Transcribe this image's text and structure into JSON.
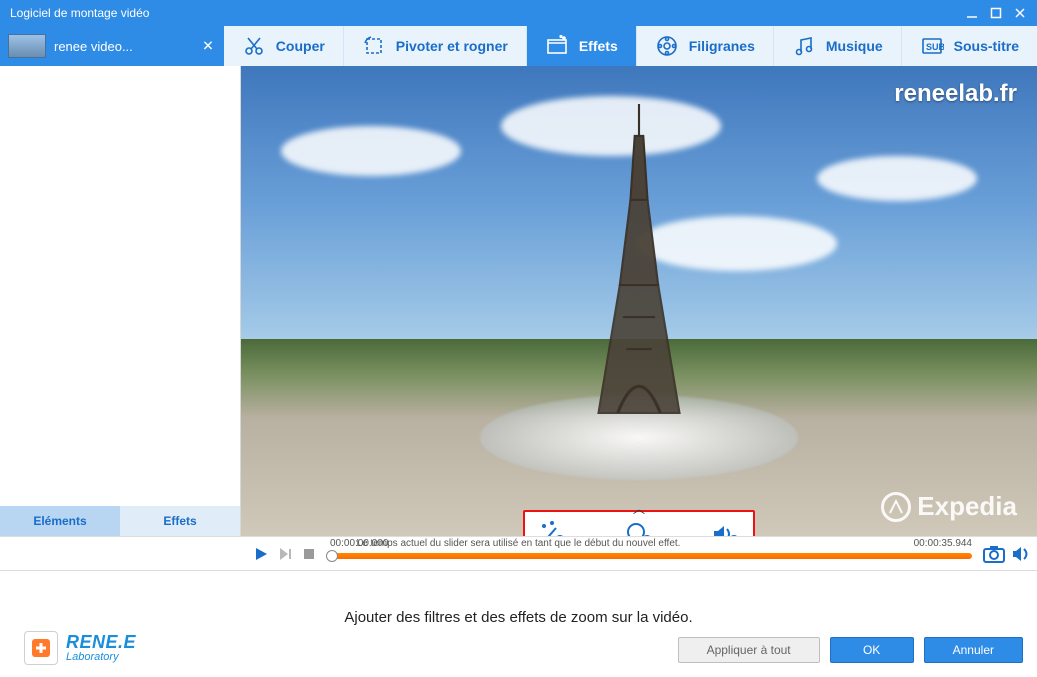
{
  "window": {
    "title": "Logiciel de montage vidéo"
  },
  "file_tab": {
    "label": "renee video...",
    "close": "✕"
  },
  "tools": [
    {
      "id": "couper",
      "label": "Couper"
    },
    {
      "id": "pivoter",
      "label": "Pivoter et rogner"
    },
    {
      "id": "effets",
      "label": "Effets",
      "active": true
    },
    {
      "id": "filigranes",
      "label": "Filigranes"
    },
    {
      "id": "musique",
      "label": "Musique"
    },
    {
      "id": "soustitre",
      "label": "Sous-titre"
    }
  ],
  "sidebar_tabs": {
    "elements": "Eléments",
    "effets": "Effets",
    "active": "elements"
  },
  "watermarks": {
    "top_right": "reneelab.fr",
    "bottom_right": "Expedia"
  },
  "popup_tools": [
    {
      "id": "wand",
      "name": "magic-wand-add-icon"
    },
    {
      "id": "zoom",
      "name": "zoom-add-icon"
    },
    {
      "id": "audio",
      "name": "audio-add-icon"
    }
  ],
  "timeline": {
    "start": "00:00:00.000",
    "end": "00:00:35.944",
    "hint": "Le temps actuel du slider sera utilisé en tant que le début du nouvel effet."
  },
  "info": {
    "message": "Ajouter des filtres et des effets de zoom sur la vidéo.",
    "brand1": "RENE.E",
    "brand2": "Laboratory"
  },
  "buttons": {
    "apply_all": "Appliquer à tout",
    "ok": "OK",
    "cancel": "Annuler"
  }
}
